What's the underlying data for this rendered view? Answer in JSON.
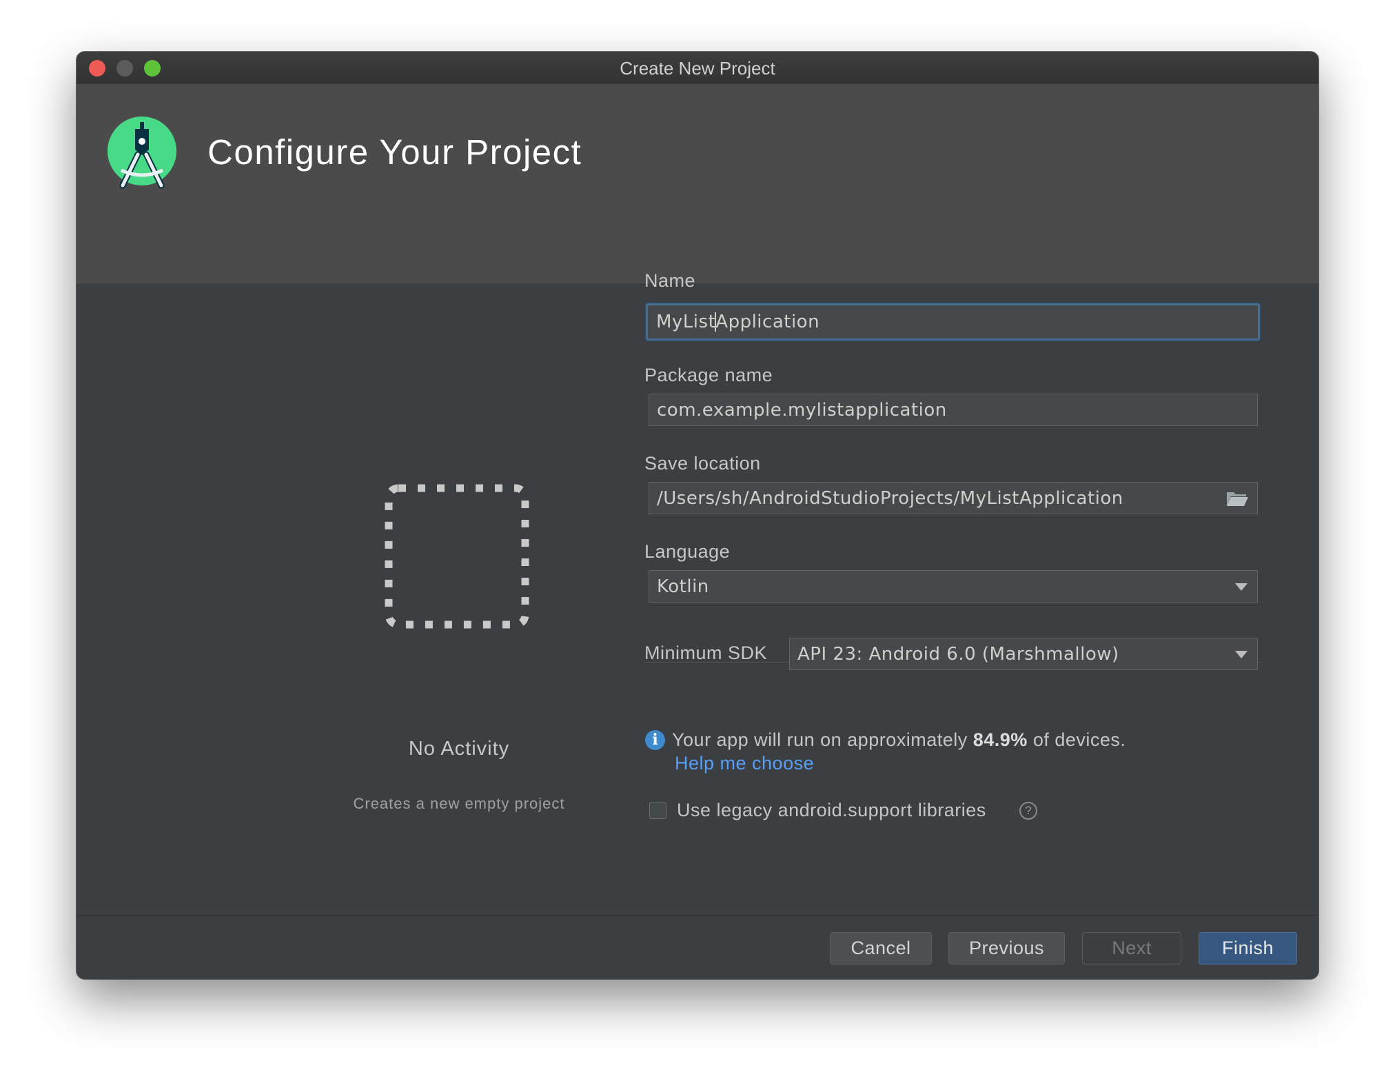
{
  "window": {
    "title": "Create New Project"
  },
  "header": {
    "title": "Configure Your Project",
    "logo_icon": "android-studio-logo-icon"
  },
  "template": {
    "name": "No Activity",
    "description": "Creates a new empty project",
    "preview_icon": "empty-activity-placeholder-icon"
  },
  "form": {
    "name_label": "Name",
    "name_before_caret": "MyList",
    "name_after_caret": "Application",
    "package_label": "Package name",
    "package_value": "com.example.mylistapplication",
    "location_label": "Save location",
    "location_value": "/Users/sh/AndroidStudioProjects/MyListApplication",
    "language_label": "Language",
    "language_value": "Kotlin",
    "min_sdk_label": "Minimum SDK",
    "min_sdk_value": "API 23: Android 6.0 (Marshmallow)",
    "info_prefix": "Your app will run on approximately ",
    "info_percent": "84.9%",
    "info_suffix": " of devices.",
    "help_link": "Help me choose",
    "legacy_label": "Use legacy android.support libraries",
    "legacy_checked": false
  },
  "buttons": {
    "cancel": "Cancel",
    "previous": "Previous",
    "next": "Next",
    "finish": "Finish"
  },
  "colors": {
    "accent_blue": "#365880",
    "focus_border": "#466d94",
    "link": "#589df6",
    "info": "#3f8bd0",
    "android_green": "#3ddc84"
  }
}
